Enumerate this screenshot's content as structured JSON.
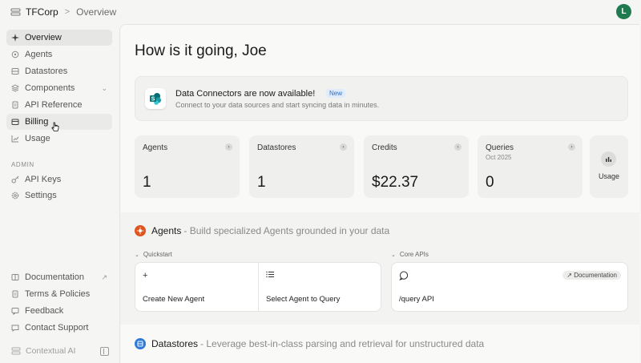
{
  "topbar": {
    "org": "TFCorp",
    "separator": ">",
    "crumb": "Overview",
    "avatar_letter": "L",
    "avatar_color": "#1f7a50"
  },
  "sidebar": {
    "items": [
      {
        "label": "Overview",
        "icon": "sparkle-icon"
      },
      {
        "label": "Agents",
        "icon": "agent-icon"
      },
      {
        "label": "Datastores",
        "icon": "database-icon"
      },
      {
        "label": "Components",
        "icon": "components-icon"
      },
      {
        "label": "API Reference",
        "icon": "document-icon"
      },
      {
        "label": "Billing",
        "icon": "billing-icon"
      },
      {
        "label": "Usage",
        "icon": "chart-icon"
      }
    ],
    "admin_label": "ADMIN",
    "admin_items": [
      {
        "label": "API Keys",
        "icon": "key-icon"
      },
      {
        "label": "Settings",
        "icon": "gear-icon"
      }
    ],
    "footer_items": [
      {
        "label": "Documentation",
        "icon": "book-icon"
      },
      {
        "label": "Terms & Policies",
        "icon": "file-icon"
      },
      {
        "label": "Feedback",
        "icon": "feedback-icon"
      },
      {
        "label": "Contact Support",
        "icon": "chat-icon"
      }
    ],
    "brand": "Contextual AI"
  },
  "main": {
    "greeting": "How is it going, Joe",
    "banner": {
      "title": "Data Connectors are now available!",
      "badge": "New",
      "subtitle": "Connect to your data sources and start syncing data in minutes."
    },
    "stats": [
      {
        "label": "Agents",
        "sub": "",
        "value": "1"
      },
      {
        "label": "Datastores",
        "sub": "",
        "value": "1"
      },
      {
        "label": "Credits",
        "sub": "",
        "value": "$22.37"
      },
      {
        "label": "Queries",
        "sub": "Oct 2025",
        "value": "0"
      }
    ],
    "usage_label": "Usage",
    "agents_section": {
      "title": "Agents",
      "description": "- Build specialized Agents grounded in your data",
      "quickstart_label": "Quickstart",
      "core_label": "Core APIs",
      "create_label": "Create New Agent",
      "select_label": "Select Agent to Query",
      "query_api_label": "/query API",
      "doc_badge": "↗ Documentation"
    },
    "datastores_section": {
      "title": "Datastores",
      "description": "- Leverage best-in-class parsing and retrieval for unstructured data"
    }
  }
}
